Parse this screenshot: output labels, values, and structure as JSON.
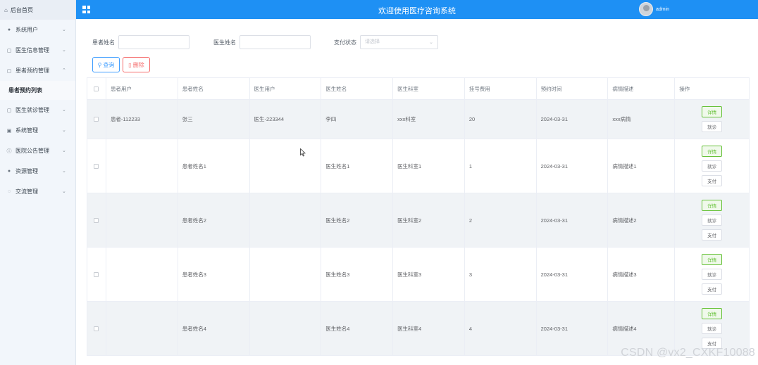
{
  "topbar": {
    "title": "欢迎使用医疗咨询系统",
    "username": "admin"
  },
  "sidebar": {
    "home": "后台首页",
    "items": [
      {
        "label": "系统用户",
        "icon": "user-icon"
      },
      {
        "label": "医生信息管理",
        "icon": "doc-icon"
      },
      {
        "label": "患者预约管理",
        "icon": "doc-icon",
        "expanded": true
      }
    ],
    "sub_active": "患者预约列表",
    "items2": [
      {
        "label": "医生就诊管理",
        "icon": "doc-icon"
      },
      {
        "label": "系统管理",
        "icon": "image-icon"
      },
      {
        "label": "医院公告管理",
        "icon": "info-icon"
      },
      {
        "label": "资源管理",
        "icon": "dot-icon"
      },
      {
        "label": "交流管理",
        "icon": "chat-icon"
      }
    ]
  },
  "filters": {
    "patient_name_label": "患者姓名",
    "doctor_name_label": "医生姓名",
    "pay_status_label": "支付状态",
    "pay_status_placeholder": "请选择"
  },
  "actions": {
    "query": "查询",
    "delete": "删除"
  },
  "table": {
    "columns": [
      "患者用户",
      "患者姓名",
      "医生用户",
      "医生姓名",
      "医生科室",
      "挂号费用",
      "预约时间",
      "病情描述",
      "操作"
    ],
    "rows": [
      {
        "patient_user": "患者-112233",
        "patient_name": "张三",
        "doctor_user": "医生-223344",
        "doctor_name": "李四",
        "dept": "xxx科室",
        "fee": "20",
        "time": "2024-03-31",
        "desc": "xxx病情",
        "ops": [
          "详情",
          "就诊"
        ]
      },
      {
        "patient_user": "",
        "patient_name": "患者姓名1",
        "doctor_user": "",
        "doctor_name": "医生姓名1",
        "dept": "医生科室1",
        "fee": "1",
        "time": "2024-03-31",
        "desc": "病情描述1",
        "ops": [
          "详情",
          "就诊",
          "支付"
        ]
      },
      {
        "patient_user": "",
        "patient_name": "患者姓名2",
        "doctor_user": "",
        "doctor_name": "医生姓名2",
        "dept": "医生科室2",
        "fee": "2",
        "time": "2024-03-31",
        "desc": "病情描述2",
        "ops": [
          "详情",
          "就诊",
          "支付"
        ]
      },
      {
        "patient_user": "",
        "patient_name": "患者姓名3",
        "doctor_user": "",
        "doctor_name": "医生姓名3",
        "dept": "医生科室3",
        "fee": "3",
        "time": "2024-03-31",
        "desc": "病情描述3",
        "ops": [
          "详情",
          "就诊",
          "支付"
        ]
      },
      {
        "patient_user": "",
        "patient_name": "患者姓名4",
        "doctor_user": "",
        "doctor_name": "医生姓名4",
        "dept": "医生科室4",
        "fee": "4",
        "time": "2024-03-31",
        "desc": "病情描述4",
        "ops": [
          "详情",
          "就诊",
          "支付"
        ]
      }
    ]
  },
  "watermark": "CSDN @vx2_CXKF10088",
  "colors": {
    "primary": "#1e90f4",
    "success": "#67c23a",
    "danger": "#f56c6c"
  }
}
